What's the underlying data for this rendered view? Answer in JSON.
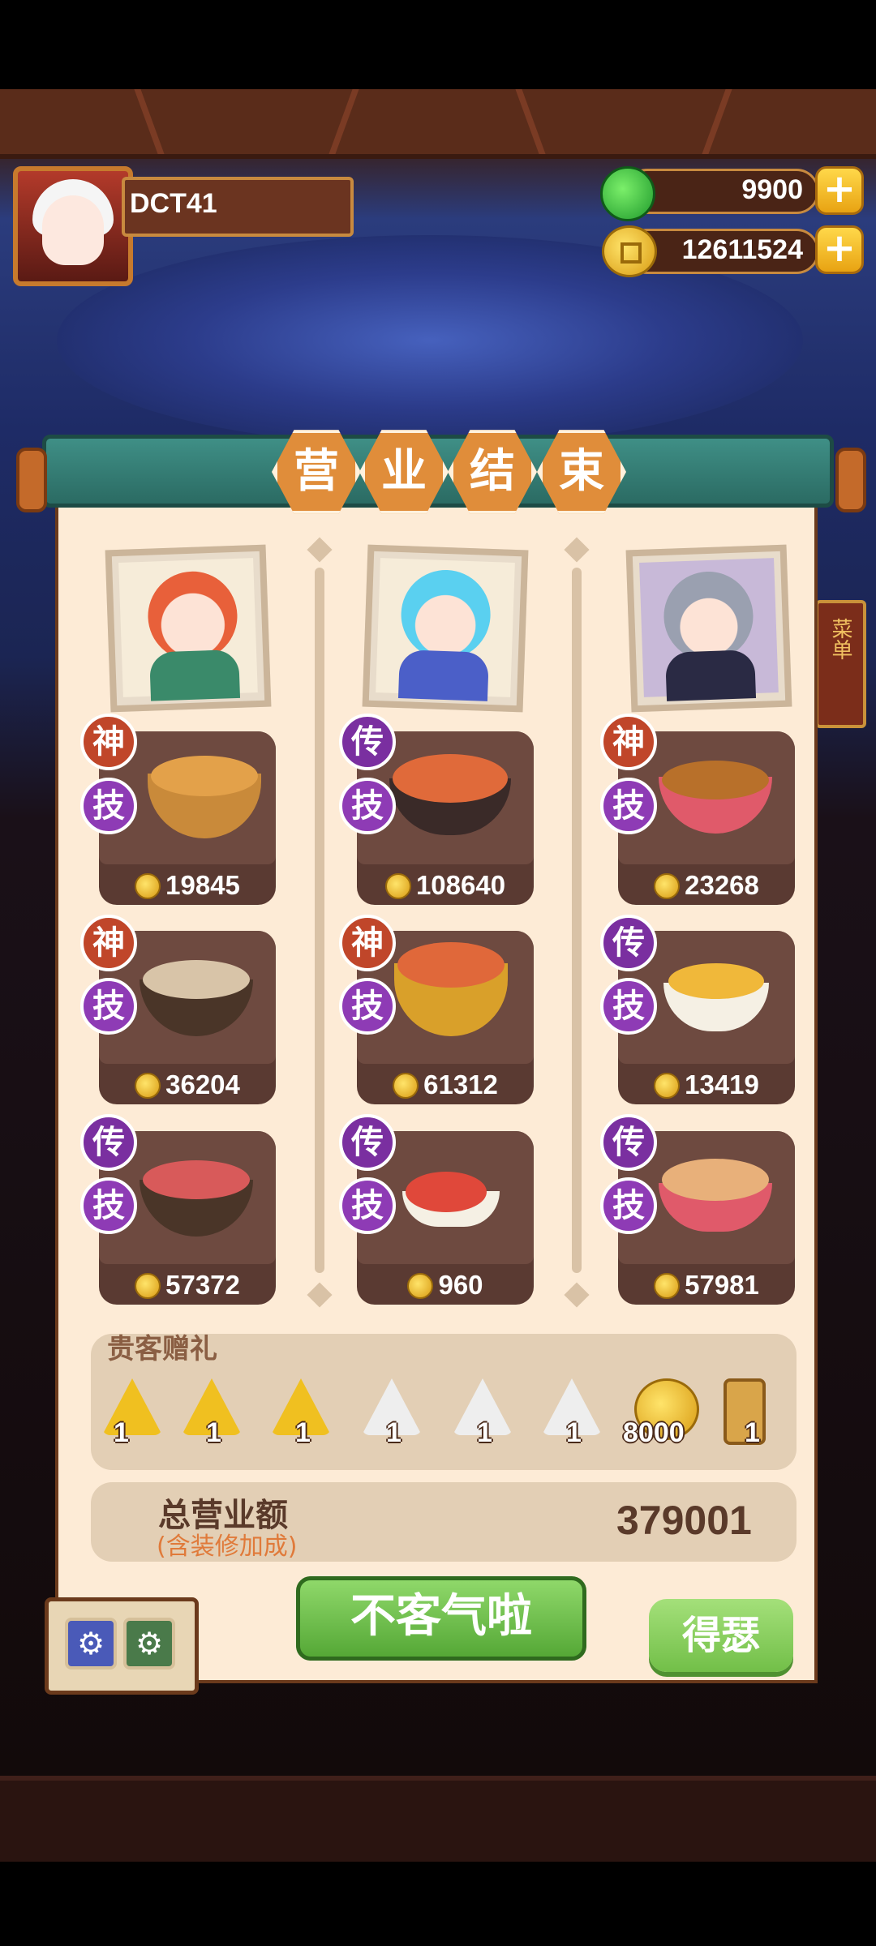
{
  "player": {
    "name": "DCT41"
  },
  "resources": {
    "jade": {
      "icon": "jade-icon",
      "value": "9900"
    },
    "coins": {
      "icon": "coin-icon",
      "value": "12611524"
    }
  },
  "side_sign": "菜单",
  "title_chars": [
    "营",
    "业",
    "结",
    "束"
  ],
  "dishes": [
    {
      "rank": "神",
      "skill": "技",
      "price": "19845",
      "rank_color": "#c0462a"
    },
    {
      "rank": "传",
      "skill": "技",
      "price": "108640",
      "rank_color": "#7a2fa0"
    },
    {
      "rank": "神",
      "skill": "技",
      "price": "23268",
      "rank_color": "#c0462a"
    },
    {
      "rank": "神",
      "skill": "技",
      "price": "36204",
      "rank_color": "#c0462a"
    },
    {
      "rank": "神",
      "skill": "技",
      "price": "61312",
      "rank_color": "#c0462a"
    },
    {
      "rank": "传",
      "skill": "技",
      "price": "13419",
      "rank_color": "#7a2fa0"
    },
    {
      "rank": "传",
      "skill": "技",
      "price": "57372",
      "rank_color": "#7a2fa0"
    },
    {
      "rank": "传",
      "skill": "技",
      "price": "960",
      "rank_color": "#7a2fa0"
    },
    {
      "rank": "传",
      "skill": "技",
      "price": "57981",
      "rank_color": "#7a2fa0"
    }
  ],
  "gifts": {
    "title": "贵客赠礼",
    "items": [
      {
        "icon": "gold-ingredient-icon",
        "count": "1"
      },
      {
        "icon": "gold-ingredient-icon",
        "count": "1"
      },
      {
        "icon": "gold-ingredient-icon",
        "count": "1"
      },
      {
        "icon": "silver-ingredient-icon",
        "count": "1"
      },
      {
        "icon": "silver-ingredient-icon",
        "count": "1"
      },
      {
        "icon": "silver-ingredient-icon",
        "count": "1"
      },
      {
        "icon": "coin-icon",
        "count": "8000"
      },
      {
        "icon": "scroll-icon",
        "count": "1"
      }
    ]
  },
  "total": {
    "label": "总营业额",
    "sub_label": "(含装修加成)",
    "value": "379001"
  },
  "buttons": {
    "decline": "不客气啦",
    "gloat": "得瑟"
  },
  "colors": {
    "panel": "#fdebd6",
    "banner": "#2b6b63",
    "accent_orange": "#e08d3a",
    "button_green": "#55a836"
  }
}
